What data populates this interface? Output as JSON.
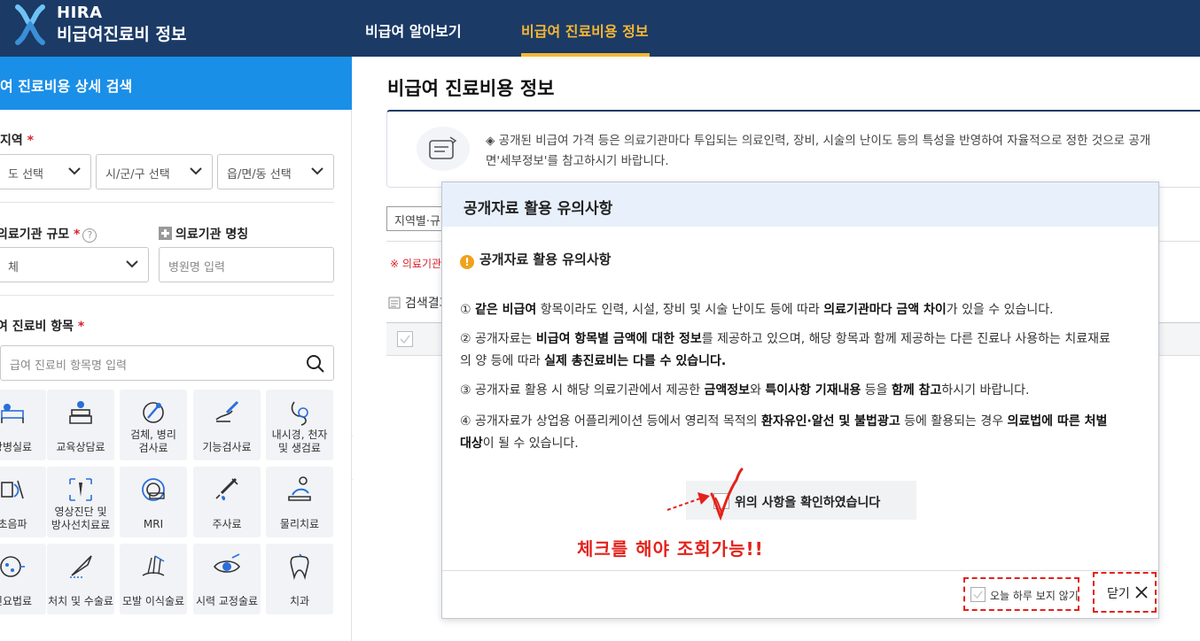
{
  "header": {
    "brand_en": "HIRA",
    "brand_ko": "비급여진료비 정보",
    "nav": [
      {
        "label": "비급여 알아보기"
      },
      {
        "label": "비급여 진료비용 정보"
      }
    ]
  },
  "left": {
    "title": "여 진료비용 상세 검색",
    "region_label": "지역",
    "region_selects": [
      "도 선택",
      "시/군/구 선택",
      "읍/면/동 선택"
    ],
    "scale_label": "의료기관 규모",
    "scale_value": "체",
    "name_label": "의료기관 명칭",
    "name_placeholder": "병원명 입력",
    "items_label": "여 진료비 항목",
    "items_placeholder": "급여 진료비 항목명 입력",
    "required_mark": "*",
    "help_mark": "?",
    "tiles": [
      {
        "l1": "상병실료",
        "l2": "",
        "icon": "bed-icon"
      },
      {
        "l1": "교육상담료",
        "l2": "",
        "icon": "consult-icon"
      },
      {
        "l1": "검체, 병리",
        "l2": "검사료",
        "icon": "microscope-icon"
      },
      {
        "l1": "기능검사료",
        "l2": "",
        "icon": "function-test-icon"
      },
      {
        "l1": "내시경, 천자",
        "l2": "및 생검료",
        "icon": "endoscope-icon"
      },
      {
        "l1": "초음파",
        "l2": "",
        "icon": "ultrasound-icon"
      },
      {
        "l1": "영상진단 및",
        "l2": "방사선치료료",
        "icon": "xray-icon"
      },
      {
        "l1": "MRI",
        "l2": "",
        "icon": "mri-icon"
      },
      {
        "l1": "주사료",
        "l2": "",
        "icon": "syringe-icon"
      },
      {
        "l1": "물리치료",
        "l2": "",
        "icon": "physio-icon"
      },
      {
        "l1": "신요법료",
        "l2": "",
        "icon": "brain-icon"
      },
      {
        "l1": "처치 및 수술료",
        "l2": "",
        "icon": "scalpel-icon"
      },
      {
        "l1": "모발 이식술료",
        "l2": "",
        "icon": "hair-icon"
      },
      {
        "l1": "시력 교정술료",
        "l2": "",
        "icon": "eye-icon"
      },
      {
        "l1": "치과",
        "l2": "",
        "icon": "tooth-icon"
      }
    ]
  },
  "main": {
    "title": "비급여 진료비용 정보",
    "notice_line1": "◈ 공개된 비급여 가격 등은 의료기관마다 투입되는 의료인력, 장비, 시술의 난이도 등의 특성을 반영하여 자율적으로 정한 것으로 공개",
    "notice_line2": "면'세부정보'를 참고하시기 바랍니다.",
    "filter_chip": "지역별·규",
    "red_note": "※ 의료기관",
    "result_label": "검색결과"
  },
  "modal": {
    "title": "공개자료 활용 유의사항",
    "subtitle": "공개자료 활용 유의사항",
    "warn_glyph": "!",
    "items": {
      "i1_pre": "① ",
      "i1_b1": "같은 비급여",
      "i1_t1": " 항목이라도 인력, 시설, 장비 및 시술 난이도 등에 따라 ",
      "i1_b2": "의료기관마다 금액 차이",
      "i1_t2": "가 있을 수 있습니다.",
      "i2_pre": "② 공개자료는 ",
      "i2_b1": "비급여 항목별 금액에 대한 정보",
      "i2_t1": "를 제공하고 있으며, 해당 항목과 함께 제공하는 다른 진료나 사용하는 치료재료",
      "i2_t2": "의 양 등에 따라 ",
      "i2_b2": "실제 총진료비는 다를 수 있습니다.",
      "i3_pre": "③ 공개자료 활용 시 해당 의료기관에서 제공한 ",
      "i3_b1": "금액정보",
      "i3_t1": "와 ",
      "i3_b2": "특이사항 기재내용",
      "i3_t2": " 등을 ",
      "i3_b3": "함께 참고",
      "i3_t3": "하시기 바랍니다.",
      "i4_pre": "④ 공개자료가 상업용 어플리케이션 등에서 영리적 목적의 ",
      "i4_b1": "환자유인·알선 및 불법광고",
      "i4_t1": " 등에 활용되는 경우 ",
      "i4_b2": "의료법에 따른 처벌",
      "i4_b3": "대상",
      "i4_t2": "이 될 수 있습니다."
    },
    "confirm_label": "위의 사항을 확인하였습니다",
    "annotation": "체크를 해야 조회가능!!",
    "today_label": "오늘 하루 보지 않기",
    "close_label": "닫기"
  },
  "colors": {
    "header_bg": "#1b3a66",
    "accent_yellow": "#f7b733",
    "left_head_bg": "#1a8fe8",
    "annotation_red": "#e3221b"
  }
}
